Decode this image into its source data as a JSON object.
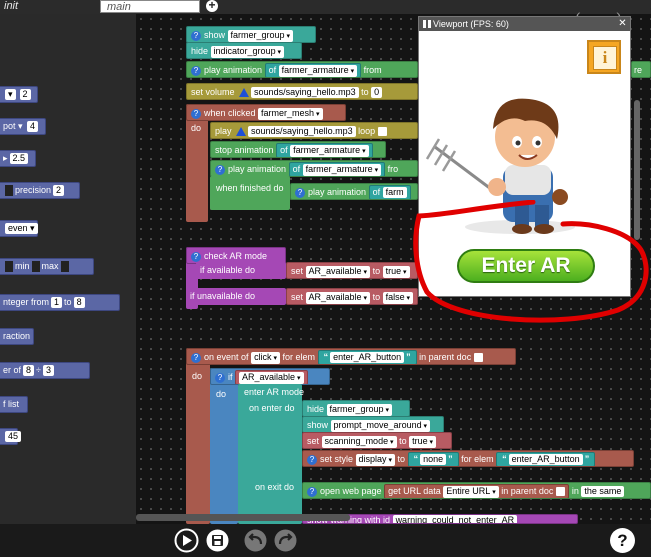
{
  "tabs": {
    "init": "init",
    "main": "main",
    "add": "+"
  },
  "flyout": {
    "b1": {
      "value": "2"
    },
    "b2": {
      "prefix": "pot",
      "value": "4"
    },
    "b3": {
      "value": "2.5"
    },
    "b4": {
      "label": "precision",
      "value": "2"
    },
    "b5": {
      "value": "even"
    },
    "b6": {
      "min": "min",
      "max": "max"
    },
    "b7": {
      "label": "nteger from",
      "from": "1",
      "to_label": "to",
      "to": "8"
    },
    "b8": {
      "label": "raction"
    },
    "b9": {
      "label": "er of",
      "a": "8",
      "op": "÷",
      "b": "3"
    },
    "b10": {
      "label": "f list"
    },
    "b11": {
      "value": "45"
    }
  },
  "blocks": {
    "show1": {
      "label": "show",
      "value": "farmer_group"
    },
    "hide1": {
      "label": "hide",
      "value": "indicator_group"
    },
    "playanim1": {
      "label": "play animation",
      "of": "of",
      "value": "farmer_armature",
      "from": "from",
      "tail": "re"
    },
    "setvol": {
      "label": "set volume",
      "file": "sounds/saying_hello.mp3",
      "to": "to",
      "value": "0"
    },
    "whenclicked": {
      "label": "when clicked",
      "value": "farmer_mesh",
      "do": "do"
    },
    "play": {
      "label": "play",
      "file": "sounds/saying_hello.mp3",
      "loop": "loop"
    },
    "stopanim": {
      "label": "stop animation",
      "of": "of",
      "value": "farmer_armature"
    },
    "playanim2": {
      "label": "play animation",
      "of": "of",
      "value": "farmer_armature",
      "tail": "fro"
    },
    "whenfinished": {
      "label": "when finished do",
      "inner": "play animation",
      "of": "of",
      "value": "farm"
    },
    "checkar": {
      "label": "check AR mode",
      "avail": "if available do",
      "unavail": "if unavailable do"
    },
    "setavail1": {
      "set": "set",
      "var": "AR_available",
      "to": "to",
      "value": "true"
    },
    "setavail2": {
      "set": "set",
      "var": "AR_available",
      "to": "to",
      "value": "false"
    },
    "onevent": {
      "label": "on event of",
      "event": "click",
      "forelem": "for elem",
      "elem": "enter_AR_button",
      "inparent": "in parent doc",
      "do": "do"
    },
    "ifblk": {
      "if": "if",
      "var": "AR_available",
      "do": "do"
    },
    "enterar": {
      "label": "enter AR mode",
      "onenter": "on enter do",
      "onexit": "on exit do"
    },
    "hide2": {
      "label": "hide",
      "value": "farmer_group"
    },
    "show2": {
      "label": "show",
      "value": "prompt_move_around"
    },
    "setscan": {
      "set": "set",
      "var": "scanning_mode",
      "to": "to",
      "value": "true"
    },
    "setstyle": {
      "label": "set style",
      "prop": "display",
      "to": "to",
      "value": "none",
      "forelem": "for elem",
      "elem": "enter_AR_button"
    },
    "openweb": {
      "label": "open web page",
      "geturl": "get URL data",
      "which": "Entire URL",
      "inparent": "in parent doc",
      "in": "in",
      "target": "the same"
    },
    "warning": {
      "label": "show warning with id",
      "value": "warning_could_not_enter_AR"
    }
  },
  "viewport": {
    "title": "Viewport (FPS: 60)",
    "close": "✕",
    "enter_ar": "Enter AR",
    "info": "i"
  },
  "nav": {
    "prev": "‹",
    "next": "›"
  },
  "help": "?",
  "colors": {
    "annotation": "#e00000",
    "accent": "#4caf1f"
  }
}
